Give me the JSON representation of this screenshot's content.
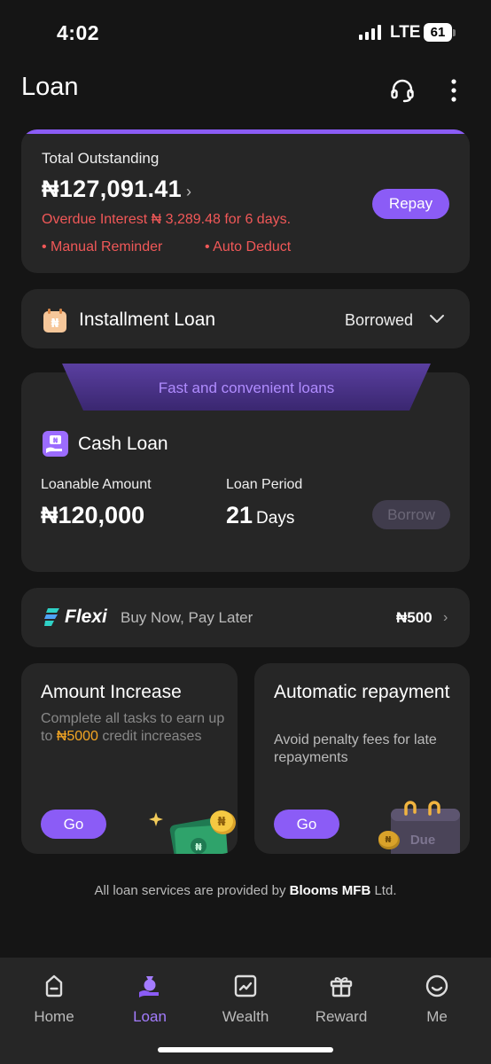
{
  "status_bar": {
    "time": "4:02",
    "network": "LTE",
    "battery": "61"
  },
  "header": {
    "title": "Loan",
    "support_icon": "headset-icon",
    "menu_icon": "more-vertical-icon"
  },
  "outstanding": {
    "label": "Total Outstanding",
    "amount": "₦127,091.41",
    "chevron": "›",
    "overdue": "Overdue Interest ₦ 3,289.48 for 6 days.",
    "tags": [
      "• Manual Reminder",
      "• Auto Deduct"
    ],
    "repay_label": "Repay",
    "accent": "#8b5cf6",
    "alert_color": "#f15858"
  },
  "installment": {
    "label": "Installment Loan",
    "status": "Borrowed",
    "icon": "calendar-naira-icon"
  },
  "cash_loan": {
    "banner": "Fast and convenient loans",
    "title": "Cash Loan",
    "loanable_label": "Loanable Amount",
    "loanable_value": "₦120,000",
    "period_label": "Loan Period",
    "period_value": "21",
    "period_unit": "Days",
    "borrow_label": "Borrow"
  },
  "flexi": {
    "name": "Flexi",
    "tagline": "Buy Now, Pay Later",
    "amount": "₦500",
    "chevron": "›"
  },
  "promos": [
    {
      "title": "Amount Increase",
      "desc_before": "Complete all tasks to earn up to ",
      "desc_highlight": "₦5000",
      "desc_after": " credit increases",
      "go_label": "Go",
      "highlight_color": "#f5a623"
    },
    {
      "title": "Automatic repayment",
      "desc": "Avoid penalty fees for late repayments",
      "go_label": "Go",
      "illustration_text": "Due"
    }
  ],
  "footer": {
    "prefix": "All loan services are provided by ",
    "provider": "Blooms MFB",
    "suffix": " Ltd."
  },
  "nav": {
    "active": "Loan",
    "items": [
      {
        "label": "Home",
        "icon": "home-icon"
      },
      {
        "label": "Loan",
        "icon": "loan-icon"
      },
      {
        "label": "Wealth",
        "icon": "chart-icon"
      },
      {
        "label": "Reward",
        "icon": "gift-icon"
      },
      {
        "label": "Me",
        "icon": "smile-icon"
      }
    ]
  }
}
